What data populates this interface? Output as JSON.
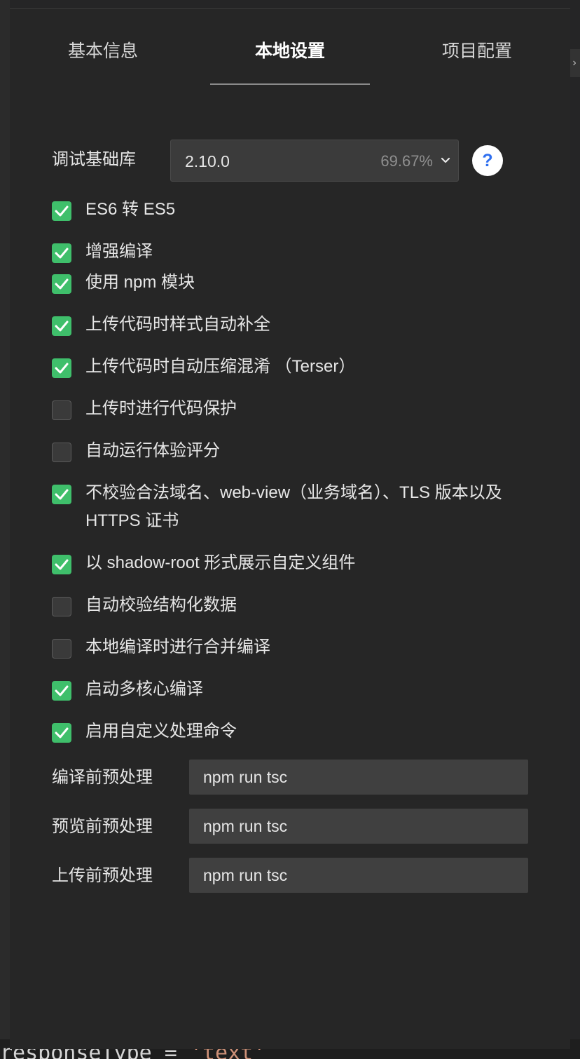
{
  "tabs": [
    {
      "label": "基本信息",
      "active": false
    },
    {
      "label": "本地设置",
      "active": true
    },
    {
      "label": "项目配置",
      "active": false
    }
  ],
  "lib": {
    "label": "调试基础库",
    "version": "2.10.0",
    "percent": "69.67%",
    "help": "?"
  },
  "options": [
    {
      "label": "ES6 转 ES5",
      "checked": true
    },
    {
      "label": "增强编译",
      "checked": true
    },
    {
      "label": "使用 npm 模块",
      "checked": true
    },
    {
      "label": "上传代码时样式自动补全",
      "checked": true
    },
    {
      "label": "上传代码时自动压缩混淆 （Terser）",
      "checked": true
    },
    {
      "label": "上传时进行代码保护",
      "checked": false
    },
    {
      "label": "自动运行体验评分",
      "checked": false
    },
    {
      "label": "不校验合法域名、web-view（业务域名）、TLS 版本以及 HTTPS 证书",
      "checked": true
    },
    {
      "label": "以 shadow-root 形式展示自定义组件",
      "checked": true
    },
    {
      "label": "自动校验结构化数据",
      "checked": false
    },
    {
      "label": "本地编译时进行合并编译",
      "checked": false
    },
    {
      "label": "启动多核心编译",
      "checked": true
    },
    {
      "label": "启用自定义处理命令",
      "checked": true
    }
  ],
  "commands": [
    {
      "label": "编译前预处理",
      "value": "npm run tsc"
    },
    {
      "label": "预览前预处理",
      "value": "npm run tsc"
    },
    {
      "label": "上传前预处理",
      "value": "npm run tsc"
    }
  ],
  "background": {
    "code_line": "responseType = ",
    "code_string": "'text'"
  },
  "colors": {
    "checkbox_on": "#3fbf6b",
    "panel_bg": "#262626",
    "help_icon": "#2f6ff0"
  }
}
